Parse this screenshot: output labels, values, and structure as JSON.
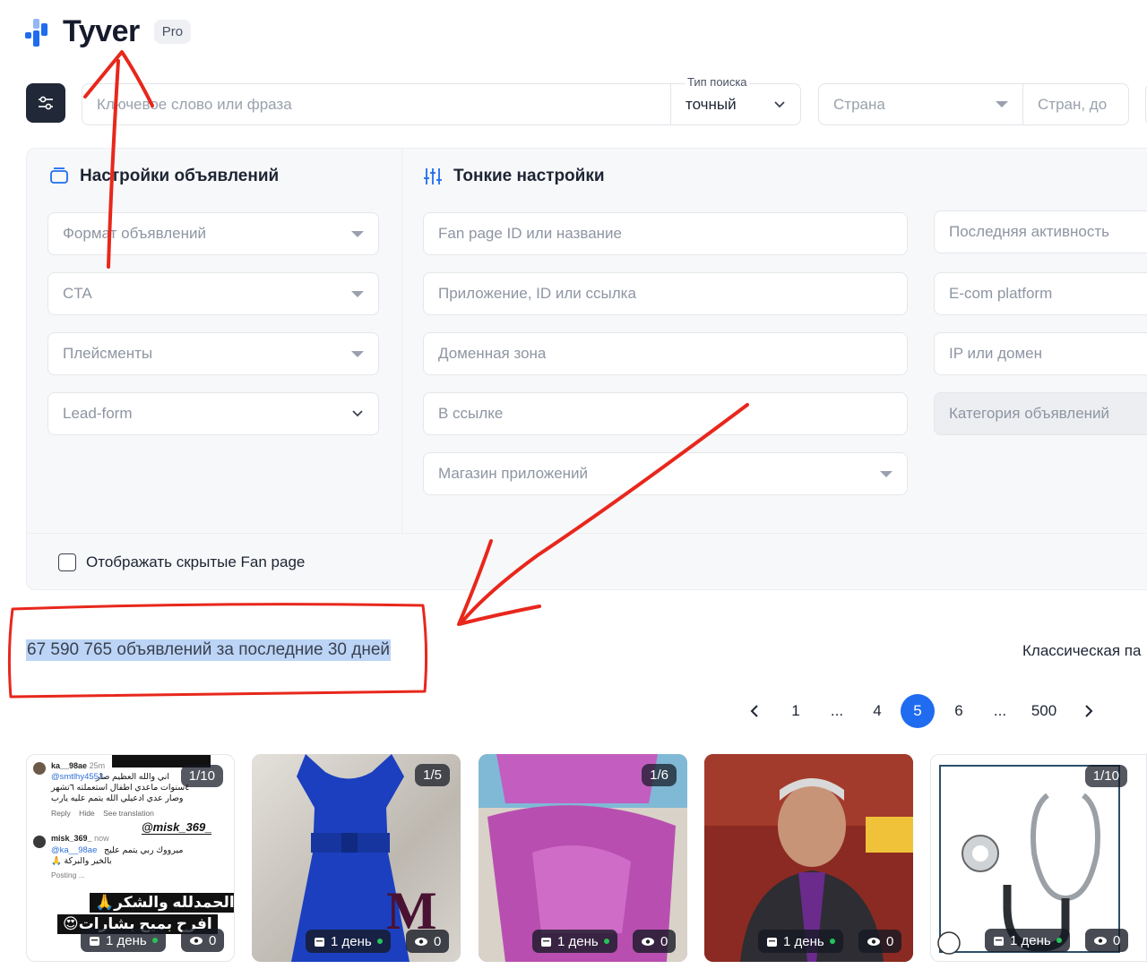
{
  "brand": {
    "name": "Tyver",
    "badge": "Pro",
    "colors": {
      "accent": "#1f6cf0",
      "dark": "#212837",
      "annotation": "#e8271c"
    }
  },
  "search": {
    "placeholder": "Ключевое слово или фраза",
    "type_label": "Тип поиска",
    "type_value": "точный",
    "country_placeholder": "Страна",
    "country_exclude_placeholder": "Стран, до"
  },
  "ad_settings": {
    "title": "Настройки объявлений",
    "fields": [
      {
        "placeholder": "Формат объявлений",
        "icon": "caret-down-icon"
      },
      {
        "placeholder": "CTA",
        "icon": "caret-down-icon"
      },
      {
        "placeholder": "Плейсменты",
        "icon": "caret-down-icon"
      },
      {
        "placeholder": "Lead-form",
        "icon": "chevron-down-icon"
      }
    ]
  },
  "fine_settings": {
    "title": "Тонкие настройки",
    "fields_left": [
      {
        "placeholder": "Fan page ID или название"
      },
      {
        "placeholder": "Приложение, ID или ссылка"
      },
      {
        "placeholder": "Доменная зона"
      },
      {
        "placeholder": "В ссылке"
      },
      {
        "placeholder": "Магазин приложений",
        "icon": "caret-down-icon"
      }
    ],
    "fields_right": [
      {
        "placeholder": "Последняя активность"
      },
      {
        "placeholder": "E-com platform"
      },
      {
        "placeholder": "IP или домен"
      },
      {
        "placeholder": "Категория объявлений",
        "disabled": true
      }
    ]
  },
  "hidden_fanpages": {
    "label": "Отображать скрытые Fan page",
    "checked": false
  },
  "results": {
    "count_text": "67 590 765 объявлений за последние 30 дней",
    "view_mode": "Классическая па"
  },
  "pagination": {
    "prev_icon": "chevron-left-icon",
    "pages": [
      "1",
      "...",
      "4",
      "5",
      "6",
      "...",
      "500"
    ],
    "current": "5",
    "next_icon": "chevron-right-icon"
  },
  "cards": [
    {
      "counter": "1/10",
      "age": "1 день",
      "views": "0",
      "texts": {
        "user1": "ka__98ae",
        "user1_time": "25m",
        "mention1": "@smtlhy4553",
        "line1": "اني والله العظيم صار",
        "line2": "٤سنوات ماعدي اطفال استعملته ٦تشهر",
        "line3": "وصار عدي ادعيلي الله يتمم عليه يارب",
        "actions": "Reply    Hide    See translation",
        "watermark": "@misk_369_",
        "user2": "misk_369_",
        "user2_time": "now",
        "mention2": "@ka__98ae",
        "line4": "ميرووك ربي يتمم عليج",
        "line5": "بالخير والبركة 🙏",
        "posting": "Posting ...",
        "banner1": "الحمدلله والشكر🙏",
        "banner2": "افرح بميح بشارات😍"
      }
    },
    {
      "counter": "1/5",
      "age": "1 день",
      "views": "0"
    },
    {
      "counter": "1/6",
      "age": "1 день",
      "views": "0"
    },
    {
      "counter": "",
      "age": "1 день",
      "views": "0"
    },
    {
      "counter": "1/10",
      "age": "1 день",
      "views": "0"
    }
  ]
}
